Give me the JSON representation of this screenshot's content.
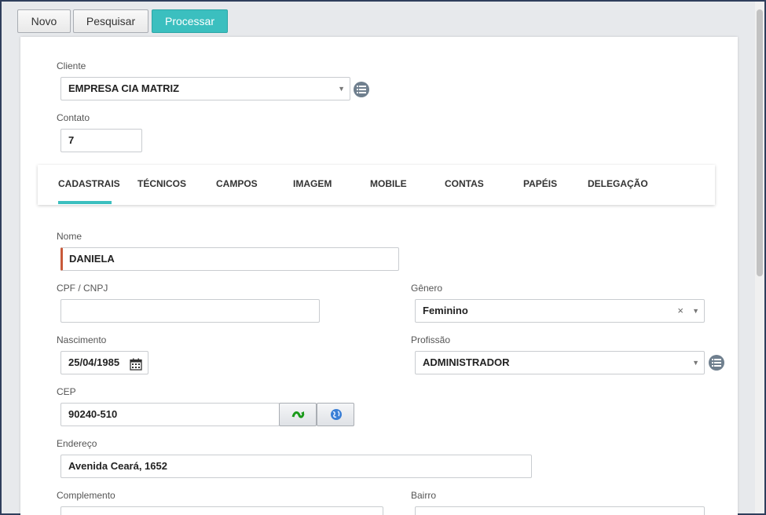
{
  "toolbar": {
    "new_label": "Novo",
    "search_label": "Pesquisar",
    "process_label": "Processar"
  },
  "client": {
    "label": "Cliente",
    "value": "EMPRESA CIA MATRIZ"
  },
  "contact": {
    "label": "Contato",
    "value": "7"
  },
  "tabs": [
    {
      "label": "CADASTRAIS",
      "active": true
    },
    {
      "label": "TÉCNICOS"
    },
    {
      "label": "CAMPOS"
    },
    {
      "label": "IMAGEM"
    },
    {
      "label": "MOBILE"
    },
    {
      "label": "CONTAS"
    },
    {
      "label": "PAPÉIS"
    },
    {
      "label": "DELEGAÇÃO"
    }
  ],
  "form": {
    "name": {
      "label": "Nome",
      "value": "DANIELA"
    },
    "cpf": {
      "label": "CPF / CNPJ",
      "value": ""
    },
    "gender": {
      "label": "Gênero",
      "value": "Feminino"
    },
    "birth": {
      "label": "Nascimento",
      "value": "25/04/1985"
    },
    "profession": {
      "label": "Profissão",
      "value": "ADMINISTRADOR"
    },
    "cep": {
      "label": "CEP",
      "value": "90240-510"
    },
    "address": {
      "label": "Endereço",
      "value": "Avenida Ceará, 1652"
    },
    "complement": {
      "label": "Complemento",
      "value": ""
    },
    "district": {
      "label": "Bairro",
      "value": ""
    }
  },
  "colors": {
    "accent": "#3bbfbf",
    "required": "#c85a3a"
  },
  "icons": {
    "list": "list-icon",
    "calendar": "calendar-icon",
    "cep_lookup": "green-arrow-icon",
    "map": "globe-icon"
  }
}
